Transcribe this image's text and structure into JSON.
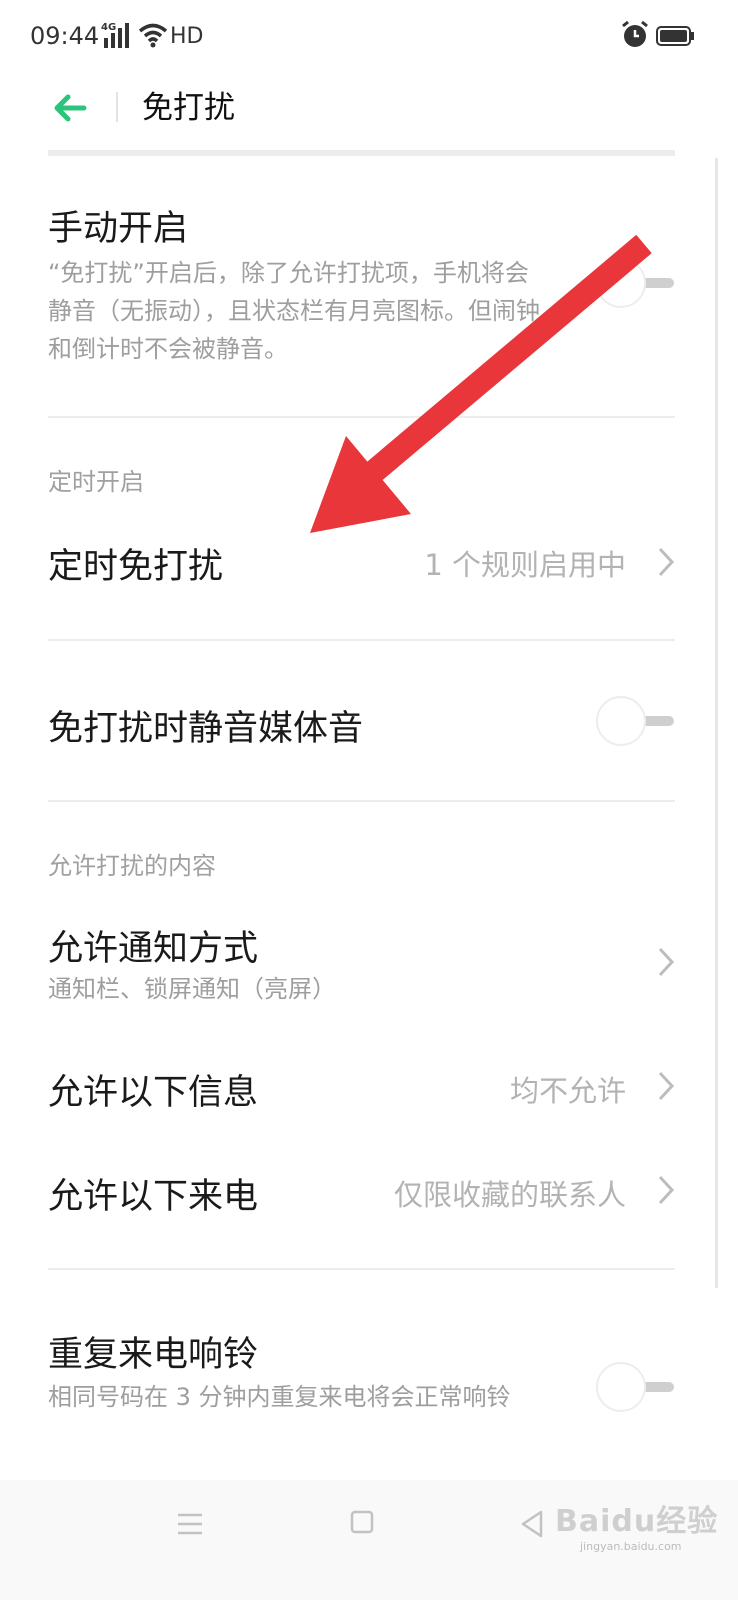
{
  "status_bar": {
    "time": "09:44",
    "network": "4G",
    "wifi_label": "HD",
    "icons": [
      "signal-icon",
      "wifi-icon",
      "alarm-icon",
      "battery-icon"
    ]
  },
  "header": {
    "title": "免打扰",
    "back_icon": "back-arrow-icon",
    "accent_color": "#2bc47b"
  },
  "manual": {
    "title": "手动开启",
    "description": "“免打扰”开启后，除了允许打扰项，手机将会静音（无振动），且状态栏有月亮图标。但闹钟和倒计时不会被静音。",
    "toggle_on": false
  },
  "section_schedule": "定时开启",
  "scheduled": {
    "title": "定时免打扰",
    "value": "1 个规则启用中"
  },
  "mute_media": {
    "title": "免打扰时静音媒体音",
    "toggle_on": false
  },
  "section_allow": "允许打扰的内容",
  "allow_notifications": {
    "title": "允许通知方式",
    "subtitle": "通知栏、锁屏通知（亮屏）"
  },
  "allow_messages": {
    "title": "允许以下信息",
    "value": "均不允许"
  },
  "allow_calls": {
    "title": "允许以下来电",
    "value": "仅限收藏的联系人"
  },
  "repeat_calls": {
    "title": "重复来电响铃",
    "description": "相同号码在 3 分钟内重复来电将会正常响铃",
    "toggle_on": false
  },
  "annotation_arrow_color": "#e8363b",
  "watermark": {
    "brand": "Baidu经验",
    "url": "jingyan.baidu.com"
  }
}
